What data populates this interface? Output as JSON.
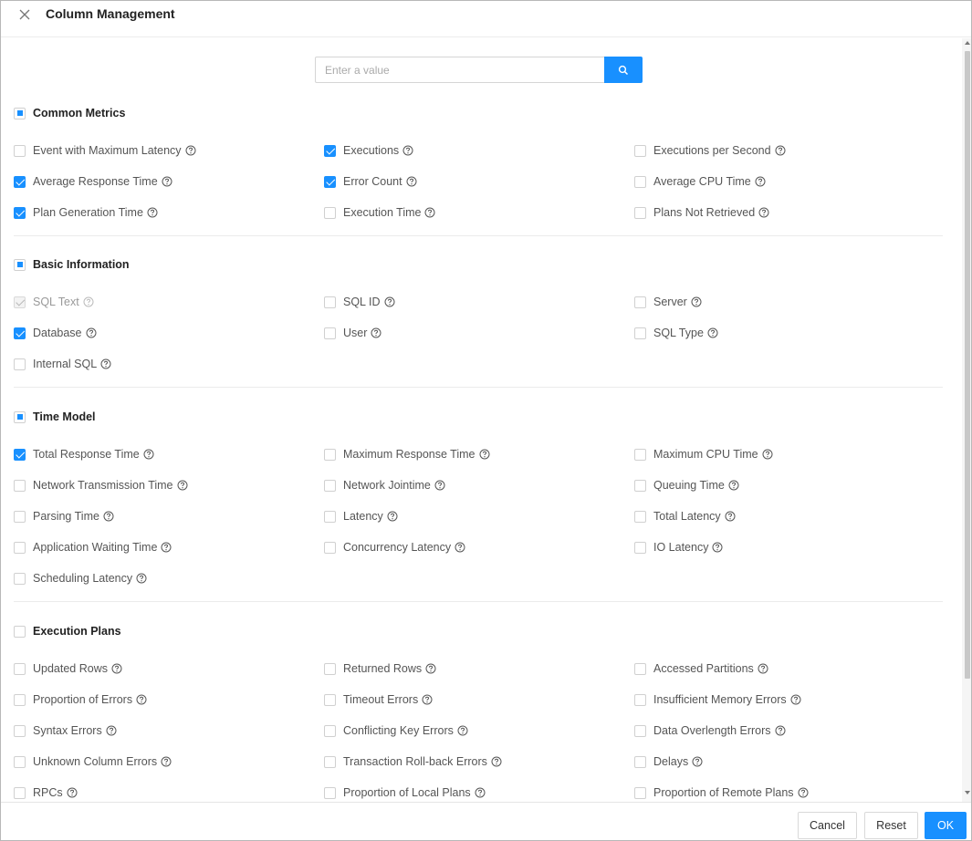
{
  "dialog": {
    "title": "Column Management",
    "search_placeholder": "Enter a value"
  },
  "sections": [
    {
      "label": "Common Metrics",
      "state": "indeterminate",
      "items": [
        {
          "label": "Event with Maximum Latency",
          "checked": false
        },
        {
          "label": "Executions",
          "checked": true
        },
        {
          "label": "Executions per Second",
          "checked": false
        },
        {
          "label": "Average Response Time",
          "checked": true
        },
        {
          "label": "Error Count",
          "checked": true
        },
        {
          "label": "Average CPU Time",
          "checked": false
        },
        {
          "label": "Plan Generation Time",
          "checked": true
        },
        {
          "label": "Execution Time",
          "checked": false
        },
        {
          "label": "Plans Not Retrieved",
          "checked": false
        }
      ]
    },
    {
      "label": "Basic Information",
      "state": "indeterminate",
      "items": [
        {
          "label": "SQL Text",
          "checked": true,
          "disabled": true
        },
        {
          "label": "SQL ID",
          "checked": false
        },
        {
          "label": "Server",
          "checked": false
        },
        {
          "label": "Database",
          "checked": true
        },
        {
          "label": "User",
          "checked": false
        },
        {
          "label": "SQL Type",
          "checked": false
        },
        {
          "label": "Internal SQL",
          "checked": false
        }
      ]
    },
    {
      "label": "Time Model",
      "state": "indeterminate",
      "items": [
        {
          "label": "Total Response Time",
          "checked": true
        },
        {
          "label": "Maximum Response Time",
          "checked": false
        },
        {
          "label": "Maximum CPU Time",
          "checked": false
        },
        {
          "label": "Network Transmission Time",
          "checked": false
        },
        {
          "label": "Network Jointime",
          "checked": false
        },
        {
          "label": "Queuing Time",
          "checked": false
        },
        {
          "label": "Parsing Time",
          "checked": false
        },
        {
          "label": "Latency",
          "checked": false
        },
        {
          "label": "Total Latency",
          "checked": false
        },
        {
          "label": "Application Waiting Time",
          "checked": false
        },
        {
          "label": "Concurrency Latency",
          "checked": false
        },
        {
          "label": "IO Latency",
          "checked": false
        },
        {
          "label": "Scheduling Latency",
          "checked": false
        }
      ]
    },
    {
      "label": "Execution Plans",
      "state": "unchecked",
      "items": [
        {
          "label": "Updated Rows",
          "checked": false
        },
        {
          "label": "Returned Rows",
          "checked": false
        },
        {
          "label": "Accessed Partitions",
          "checked": false
        },
        {
          "label": "Proportion of Errors",
          "checked": false
        },
        {
          "label": "Timeout Errors",
          "checked": false
        },
        {
          "label": "Insufficient Memory Errors",
          "checked": false
        },
        {
          "label": "Syntax Errors",
          "checked": false
        },
        {
          "label": "Conflicting Key Errors",
          "checked": false
        },
        {
          "label": "Data Overlength Errors",
          "checked": false
        },
        {
          "label": "Unknown Column Errors",
          "checked": false
        },
        {
          "label": "Transaction Roll-back Errors",
          "checked": false
        },
        {
          "label": "Delays",
          "checked": false
        },
        {
          "label": "RPCs",
          "checked": false
        },
        {
          "label": "Proportion of Local Plans",
          "checked": false
        },
        {
          "label": "Proportion of Remote Plans",
          "checked": false
        }
      ]
    }
  ],
  "footer": {
    "cancel_label": "Cancel",
    "reset_label": "Reset",
    "ok_label": "OK"
  },
  "icons": {
    "close": "close-icon",
    "search": "search-icon",
    "help": "question-circle-icon"
  },
  "colors": {
    "primary": "#1890ff",
    "text": "#555555",
    "title": "#222222"
  }
}
